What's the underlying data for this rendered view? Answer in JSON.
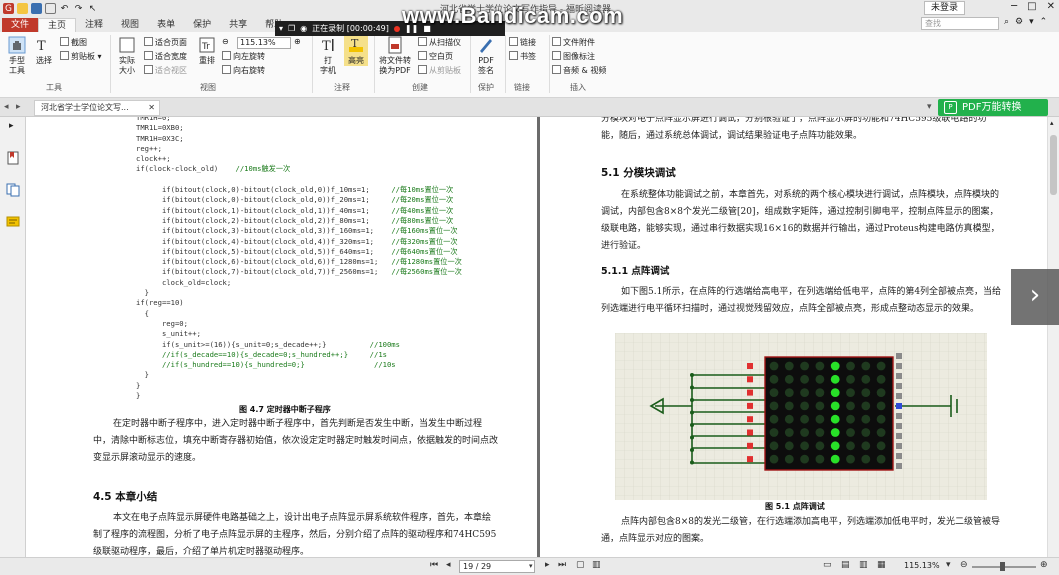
{
  "app": {
    "title": "河北省学士学位论文写作指导 - 福昕阅读器",
    "watermark": "www.Bandicam.com",
    "login": "未登录",
    "search_placeholder": "查找"
  },
  "tabs": [
    "文件",
    "主页",
    "注释",
    "视图",
    "表单",
    "保护",
    "共享",
    "帮助"
  ],
  "recording": {
    "label": "正在录制 [00:00:49]"
  },
  "ribbon": {
    "hand_tool": "手型\n工具",
    "select": "选择",
    "snapshot": "截图",
    "clipboard": "剪贴板",
    "actual_size": "实际\n大小",
    "fit_page": "适合页面",
    "fit_width": "适合宽度",
    "fit_visible": "适合视区",
    "reflow": "重排",
    "zoom": "115.13%",
    "rotate_left": "向左旋转",
    "rotate_right": "向右旋转",
    "typewriter": "打\n字机",
    "highlight": "高亮",
    "convert": "将文件转\n换为PDF",
    "from_scanner": "从扫描仪",
    "blank_page": "空白页",
    "from_clipboard": "从剪贴板",
    "pdf_sign": "PDF\n签名",
    "link": "链接",
    "bookmark": "书签",
    "file_attach": "文件附件",
    "image_annot": "图像标注",
    "audio_video": "音频 & 视频",
    "groups": {
      "tools": "工具",
      "view": "视图",
      "comment": "注释",
      "create": "创建",
      "protect": "保护",
      "link": "链接",
      "insert": "插入"
    }
  },
  "doc_tab": {
    "label": "河北省学士学位论文写..."
  },
  "pdf_convert": {
    "label": "PDF万能转换"
  },
  "left_page": {
    "code_lines": [
      "TMR1H=0;",
      "TMR1L=0XB0;",
      "TMR1H=0X3C;",
      "reg++;",
      "clock++;",
      "if(clock-clock_old)    //10ms触发一次",
      "",
      "      if(bitout(clock,0)-bitout(clock_old,0))f_10ms=1;     //每10ms置位一次",
      "      if(bitout(clock,0)-bitout(clock_old,0))f_20ms=1;     //每20ms置位一次",
      "      if(bitout(clock,1)-bitout(clock_old,1))f_40ms=1;     //每40ms置位一次",
      "      if(bitout(clock,2)-bitout(clock_old,2))f_80ms=1;     //每80ms置位一次",
      "      if(bitout(clock,3)-bitout(clock_old,3))f_160ms=1;    //每160ms置位一次",
      "      if(bitout(clock,4)-bitout(clock_old,4))f_320ms=1;    //每320ms置位一次",
      "      if(bitout(clock,5)-bitout(clock_old,5))f_640ms=1;    //每640ms置位一次",
      "      if(bitout(clock,6)-bitout(clock_old,6))f_1280ms=1;   //每1280ms置位一次",
      "      if(bitout(clock,7)-bitout(clock_old,7))f_2560ms=1;   //每2560ms置位一次",
      "      clock_old=clock;",
      "  }",
      "if(reg==10)",
      "  {",
      "      reg=0;",
      "      s_unit++;",
      "      if(s_unit>=(16)){s_unit=0;s_decade++;}          //100ms",
      "      //if(s_decade==10){s_decade=0;s_hundred++;}     //1s",
      "      //if(s_hundred==10){s_hundred=0;}                //10s",
      "  }",
      "}",
      "}"
    ],
    "figure_caption": "图 4.7    定时器中断子程序",
    "para1": "在定时器中断子程序中，进入定时器中断子程序中，首先判断是否发生中断，当发生中断过程中，清除中断标志位，填充中断寄存器初始值，依次设定定时器定时触发时间点，依据触发的时间点改变显示屏滚动显示的速度。",
    "section": "4.5    本章小结",
    "para2": "本文在电子点阵显示屏硬件电路基础之上，设计出电子点阵显示屏系统软件程序，首先，本章绘制了程序的流程图，分析了电子点阵显示屏的主程序，然后，分别介绍了点阵的驱动程序和74HC595级联驱动程序，最后，介绍了单片机定时器驱动程序。"
  },
  "right_page": {
    "para0": "分模块对电子点阵显示屏进行调试，分别根验证了，点阵显示屏的功能和74HC595级联电路的功能，随后，通过系统总体调试，调试结果验证电子点阵功能效果。",
    "section": "5.1    分模块调试",
    "para1": "在系统整体功能调试之前，本章首先，对系统的两个核心模块进行调试，点阵模块，点阵模块的调试，内部包含8×8个发光二级管[20]，组成数字矩阵，通过控制引脚电平，控制点阵显示的图案，级联电路，能够实现，通过串行数据实现16×16的数据并行输出，通过Proteus构建电路仿真模型，进行验证。",
    "subsection": "5.1.1    点阵调试",
    "para2": "如下图5.1所示，在点阵的行选端给高电平，在列选端给低电平，点阵的第4列全部被点亮，当给列选端进行电平循环扫描时，通过视觉残留效应，点阵全部被点亮，形成点整动态显示的效果。",
    "figure_caption": "图 5.1    点阵调试",
    "para3": "点阵内部包含8×8的发光二级管，在行选端添加高电平，列选端添加低电平时，发光二级管被导通，点阵显示对应的图案。"
  },
  "status": {
    "page_indicator": "19 / 29",
    "zoom": "115.13%"
  }
}
